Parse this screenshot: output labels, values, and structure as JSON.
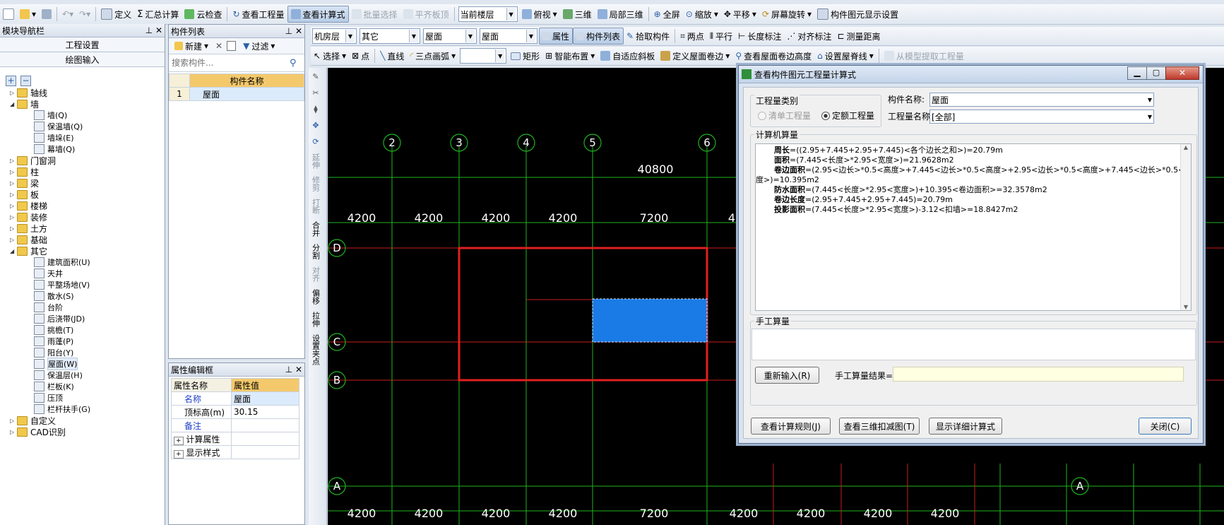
{
  "toolbar1": {
    "define": "定义",
    "sum": "汇总计算",
    "cloud_check": "云检查",
    "view_qty": "查看工程量",
    "view_formula": "查看计算式",
    "batch_select": "批量选择",
    "align_slab": "平齐板顶",
    "floor_select": "当前楼层",
    "top_view": "俯视",
    "three_d": "三维",
    "local_3d": "局部三维",
    "fullscreen": "全屏",
    "zoom": "缩放",
    "pan": "平移",
    "rotate": "屏幕旋转",
    "display_setting": "构件图元显示设置"
  },
  "toolbar2": {
    "layer": "机房层",
    "type": "其它",
    "comp_type": "屋面",
    "comp_name": "屋面",
    "property": "属性",
    "comp_list": "构件列表",
    "pick": "拾取构件",
    "two_point": "两点",
    "parallel": "平行",
    "length_dim": "长度标注",
    "align_dim": "对齐标注",
    "measure": "测量距离"
  },
  "toolbar3": {
    "select": "选择",
    "point": "点",
    "line": "直线",
    "arc3": "三点画弧",
    "rect": "矩形",
    "smart": "智能布置",
    "auto_slope": "自适应斜板",
    "def_roll": "定义屋面卷边",
    "view_roll": "查看屋面卷边高度",
    "set_ridge": "设置屋脊线",
    "extract": "从模型提取工程量"
  },
  "nav": {
    "title": "模块导航栏",
    "btn_settings": "工程设置",
    "btn_draw": "绘图输入",
    "tree": [
      {
        "label": "轴线",
        "level": 0,
        "expand": "▷",
        "kind": "folder"
      },
      {
        "label": "墙",
        "level": 0,
        "expand": "◢",
        "kind": "folder"
      },
      {
        "label": "墙(Q)",
        "level": 1,
        "kind": "leaf"
      },
      {
        "label": "保温墙(Q)",
        "level": 1,
        "kind": "leaf"
      },
      {
        "label": "墙垛(E)",
        "level": 1,
        "kind": "leaf"
      },
      {
        "label": "幕墙(Q)",
        "level": 1,
        "kind": "leaf"
      },
      {
        "label": "门窗洞",
        "level": 0,
        "expand": "▷",
        "kind": "folder"
      },
      {
        "label": "柱",
        "level": 0,
        "expand": "▷",
        "kind": "folder"
      },
      {
        "label": "梁",
        "level": 0,
        "expand": "▷",
        "kind": "folder"
      },
      {
        "label": "板",
        "level": 0,
        "expand": "▷",
        "kind": "folder"
      },
      {
        "label": "楼梯",
        "level": 0,
        "expand": "▷",
        "kind": "folder"
      },
      {
        "label": "装修",
        "level": 0,
        "expand": "▷",
        "kind": "folder"
      },
      {
        "label": "土方",
        "level": 0,
        "expand": "▷",
        "kind": "folder"
      },
      {
        "label": "基础",
        "level": 0,
        "expand": "▷",
        "kind": "folder"
      },
      {
        "label": "其它",
        "level": 0,
        "expand": "◢",
        "kind": "folder"
      },
      {
        "label": "建筑面积(U)",
        "level": 1,
        "kind": "leaf"
      },
      {
        "label": "天井",
        "level": 1,
        "kind": "leaf"
      },
      {
        "label": "平整场地(V)",
        "level": 1,
        "kind": "leaf"
      },
      {
        "label": "散水(S)",
        "level": 1,
        "kind": "leaf"
      },
      {
        "label": "台阶",
        "level": 1,
        "kind": "leaf"
      },
      {
        "label": "后浇带(JD)",
        "level": 1,
        "kind": "leaf"
      },
      {
        "label": "挑檐(T)",
        "level": 1,
        "kind": "leaf"
      },
      {
        "label": "雨蓬(P)",
        "level": 1,
        "kind": "leaf"
      },
      {
        "label": "阳台(Y)",
        "level": 1,
        "kind": "leaf"
      },
      {
        "label": "屋面(W)",
        "level": 1,
        "kind": "leaf"
      },
      {
        "label": "保温层(H)",
        "level": 1,
        "kind": "leaf"
      },
      {
        "label": "栏板(K)",
        "level": 1,
        "kind": "leaf"
      },
      {
        "label": "压顶",
        "level": 1,
        "kind": "leaf"
      },
      {
        "label": "栏杆扶手(G)",
        "level": 1,
        "kind": "leaf"
      },
      {
        "label": "自定义",
        "level": 0,
        "expand": "▷",
        "kind": "folder"
      },
      {
        "label": "CAD识别",
        "level": 0,
        "expand": "▷",
        "kind": "folder"
      }
    ]
  },
  "complist": {
    "title": "构件列表",
    "new": "新建",
    "filter": "过滤",
    "search_placeholder": "搜索构件...",
    "col_name": "构件名称",
    "row_no": "1",
    "row_name": "屋面"
  },
  "props": {
    "title": "属性编辑框",
    "col_name": "属性名称",
    "col_value": "属性值",
    "rows": [
      {
        "name": "名称",
        "value": "屋面"
      },
      {
        "name": "顶标高(m)",
        "value": "30.15"
      },
      {
        "name": "备注",
        "value": ""
      },
      {
        "name": "计算属性",
        "value": ""
      },
      {
        "name": "显示样式",
        "value": ""
      }
    ]
  },
  "vtools": {
    "extend": "延伸",
    "trim": "修剪",
    "break": "打断",
    "merge": "合并",
    "split": "分割",
    "align": "对齐",
    "offset": "偏移",
    "stretch": "拉伸",
    "setpoint": "设置夹点"
  },
  "canvas": {
    "axis_top": [
      "2",
      "3",
      "4",
      "5",
      "6"
    ],
    "axis_left": [
      "D",
      "C",
      "B",
      "A"
    ],
    "axis_right_a": "A",
    "dim_total": "40800",
    "dims_top": [
      "4200",
      "4200",
      "4200",
      "4200",
      "7200",
      "4"
    ],
    "dims_bottom": [
      "4200",
      "4200",
      "4200",
      "4200",
      "7200",
      "4200",
      "4200",
      "4200",
      "4200"
    ]
  },
  "dialog": {
    "title": "查看构件图元工程量计算式",
    "qty_type_label": "工程量类别",
    "radio_list": "清单工程量",
    "radio_quota": "定额工程量",
    "comp_name_label": "构件名称:",
    "comp_name_value": "屋面",
    "qty_name_label": "工程量名称:",
    "qty_name_value": "[全部]",
    "machine_label": "计算机算量",
    "lines": [
      {
        "key": "周长",
        "text": "=((2.95+7.445+2.95+7.445)<各个边长之和>)=20.79m"
      },
      {
        "key": "面积",
        "text": "=(7.445<长度>*2.95<宽度>)=21.9628m2"
      },
      {
        "key": "卷边面积",
        "text": "=(2.95<边长>*0.5<高度>+7.445<边长>*0.5<高度>+2.95<边长>*0.5<高度>+7.445<边长>*0.5<高"
      },
      {
        "key": "",
        "text": "度>)=10.395m2"
      },
      {
        "key": "防水面积",
        "text": "=(7.445<长度>*2.95<宽度>)+10.395<卷边面积>=32.3578m2"
      },
      {
        "key": "卷边长度",
        "text": "=(2.95+7.445+2.95+7.445)=20.79m"
      },
      {
        "key": "投影面积",
        "text": "=(7.445<长度>*2.95<宽度>)-3.12<扣墙>=18.8427m2"
      }
    ],
    "manual_label": "手工算量",
    "reenter": "重新输入(R)",
    "manual_result_label": "手工算量结果=",
    "btn_rules": "查看计算规则(J)",
    "btn_3d": "查看三维扣减图(T)",
    "btn_detail": "显示详细计算式",
    "btn_close": "关闭(C)"
  }
}
